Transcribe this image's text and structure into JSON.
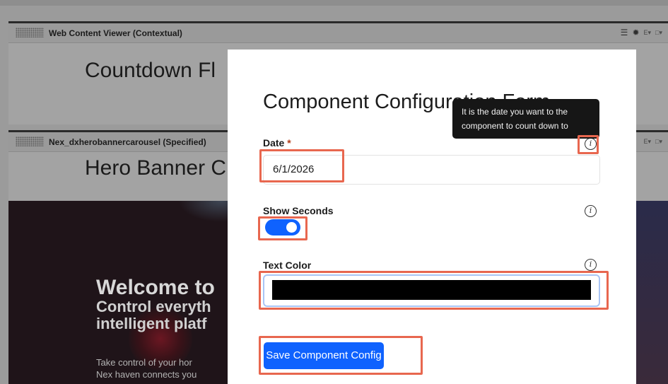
{
  "portal": {
    "portlet1": {
      "title": "Web Content Viewer (Contextual)",
      "heading": "Countdown Fl"
    },
    "portlet2": {
      "title": "Nex_dxherobannercarousel (Specified)",
      "heading": "Hero Banner C"
    },
    "tools": {
      "menu": "☰",
      "gear": "✹",
      "edit": "E▾",
      "window": "□▾"
    },
    "hero": {
      "headline": "Welcome to",
      "subline1": "Control everyth",
      "subline2": "intelligent platf",
      "body1": "Take control of your hor",
      "body2": "Nex haven connects you"
    }
  },
  "form": {
    "title": "Component Configuration Form",
    "date": {
      "label": "Date",
      "required_mark": "*",
      "value": "6/1/2026",
      "info_icon": "i"
    },
    "show_seconds": {
      "label": "Show Seconds",
      "checked": true,
      "info_icon": "i"
    },
    "text_color": {
      "label": "Text Color",
      "value": "#000000",
      "info_icon": "i"
    },
    "save_label": "Save Component Config",
    "tooltip": "It is the date you want to the component to count down to"
  },
  "colors": {
    "primary": "#0f62fe",
    "highlight": "#e8674f",
    "required": "#b23c17"
  }
}
